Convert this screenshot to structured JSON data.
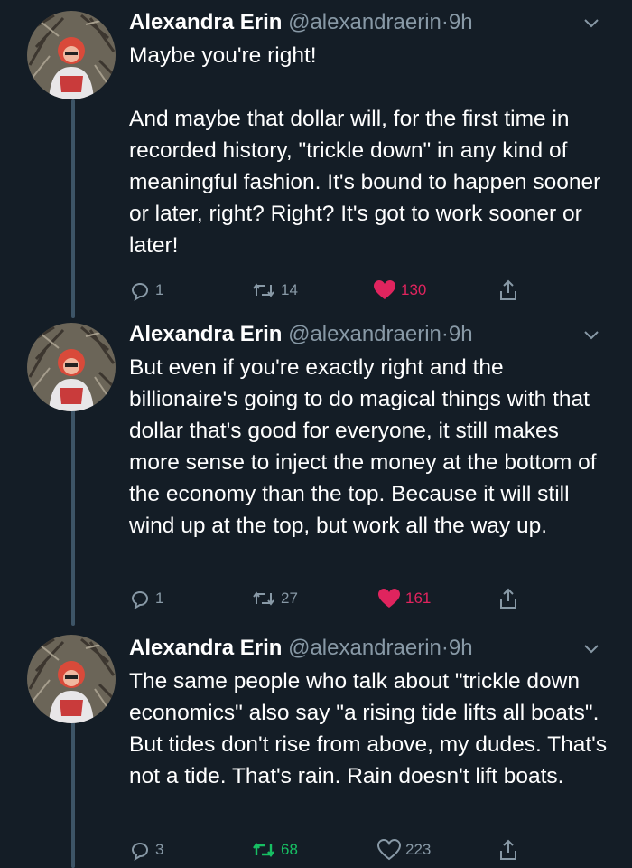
{
  "tweets": [
    {
      "name": "Alexandra Erin",
      "handle": "@alexandraerin",
      "time": "9h",
      "text": "Maybe you're right!\n\nAnd maybe that dollar will, for the first time in recorded history, \"trickle down\" in any kind of meaningful fashion. It's bound to happen sooner or later, right? Right? It's got to work sooner or later!",
      "replies": "1",
      "retweets": "14",
      "likes": "130",
      "liked": true,
      "retweeted": false
    },
    {
      "name": "Alexandra Erin",
      "handle": "@alexandraerin",
      "time": "9h",
      "text": "But even if you're exactly right and the billionaire's going to do magical things with that dollar that's good for everyone, it still makes more sense to inject the money at the bottom of the economy than the top. Because it will still wind up at the top, but work all the way up.",
      "replies": "1",
      "retweets": "27",
      "likes": "161",
      "liked": true,
      "retweeted": false
    },
    {
      "name": "Alexandra Erin",
      "handle": "@alexandraerin",
      "time": "9h",
      "text": "The same people who talk about \"trickle down economics\" also say \"a rising tide lifts all boats\". But tides don't rise from above, my dudes. That's not a tide. That's rain. Rain doesn't lift boats.",
      "replies": "3",
      "retweets": "68",
      "likes": "223",
      "liked": false,
      "retweeted": true
    }
  ],
  "separator": "·",
  "colors": {
    "background": "#141d26",
    "secondary_text": "#8899a6",
    "like": "#e0245e",
    "retweet": "#17bf63",
    "thread_line": "#3d5466"
  },
  "icons": [
    "reply-icon",
    "retweet-icon",
    "heart-icon",
    "share-icon",
    "chevron-down-icon"
  ]
}
